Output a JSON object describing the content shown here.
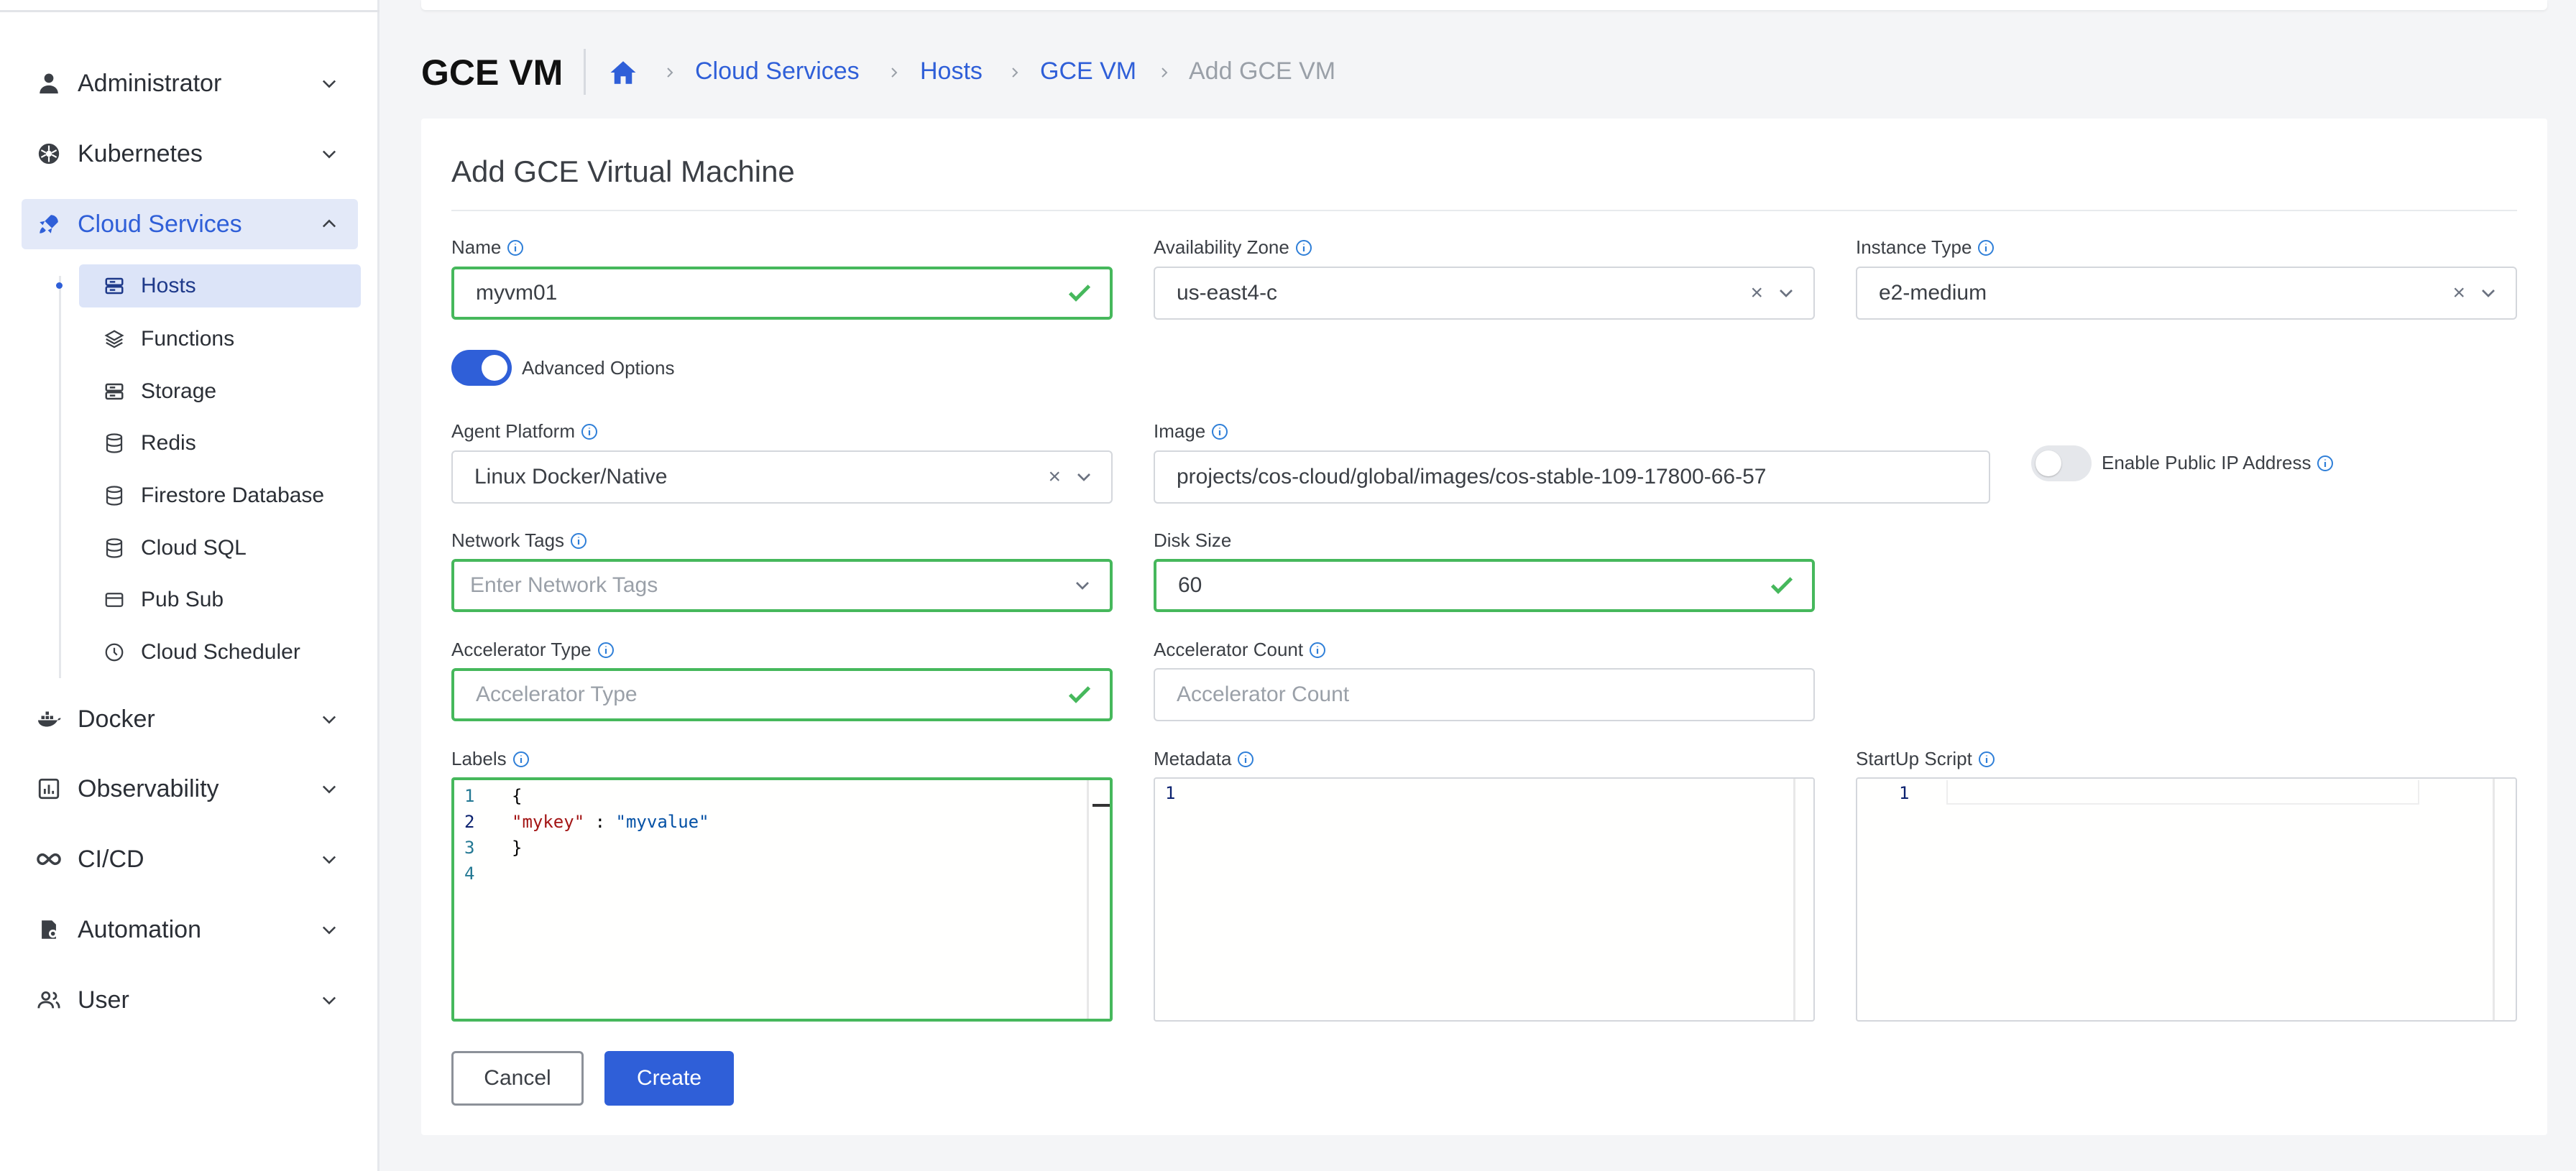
{
  "sidebar": {
    "items": [
      {
        "label": "Administrator",
        "icon": "user-icon"
      },
      {
        "label": "Kubernetes",
        "icon": "kubernetes-icon"
      },
      {
        "label": "Cloud Services",
        "icon": "rocket-icon"
      },
      {
        "label": "Docker",
        "icon": "docker-icon"
      },
      {
        "label": "Observability",
        "icon": "chart-icon"
      },
      {
        "label": "CI/CD",
        "icon": "infinity-icon"
      },
      {
        "label": "Automation",
        "icon": "automation-icon"
      },
      {
        "label": "User",
        "icon": "users-icon"
      }
    ],
    "subitems": [
      {
        "label": "Hosts",
        "icon": "server-icon"
      },
      {
        "label": "Functions",
        "icon": "layers-icon"
      },
      {
        "label": "Storage",
        "icon": "server-icon"
      },
      {
        "label": "Redis",
        "icon": "database-icon"
      },
      {
        "label": "Firestore Database",
        "icon": "database-icon"
      },
      {
        "label": "Cloud SQL",
        "icon": "database-icon"
      },
      {
        "label": "Pub Sub",
        "icon": "card-icon"
      },
      {
        "label": "Cloud Scheduler",
        "icon": "clock-icon"
      }
    ]
  },
  "header": {
    "title": "GCE VM",
    "breadcrumb": [
      "Cloud Services",
      "Hosts",
      "GCE VM",
      "Add GCE VM"
    ]
  },
  "form": {
    "title": "Add GCE Virtual Machine",
    "name_label": "Name",
    "name_value": "myvm01",
    "zone_label": "Availability Zone",
    "zone_value": "us-east4-c",
    "instance_label": "Instance Type",
    "instance_value": "e2-medium",
    "advanced_label": "Advanced Options",
    "advanced_on": true,
    "agent_label": "Agent Platform",
    "agent_value": "Linux Docker/Native",
    "image_label": "Image",
    "image_value": "projects/cos-cloud/global/images/cos-stable-109-17800-66-57",
    "public_ip_label": "Enable Public IP Address",
    "public_ip_on": false,
    "network_label": "Network Tags",
    "network_placeholder": "Enter Network Tags",
    "disk_label": "Disk Size",
    "disk_value": "60",
    "accel_type_label": "Accelerator Type",
    "accel_type_placeholder": "Accelerator Type",
    "accel_count_label": "Accelerator Count",
    "accel_count_placeholder": "Accelerator Count",
    "labels_label": "Labels",
    "labels_lines": [
      {
        "num": "1",
        "text": "{"
      },
      {
        "num": "2",
        "key": "\"mykey\"",
        "sep": " : ",
        "val": "\"myvalue\""
      },
      {
        "num": "3",
        "text": "}"
      },
      {
        "num": "4",
        "text": ""
      }
    ],
    "metadata_label": "Metadata",
    "metadata_line": "1",
    "startup_label": "StartUp Script",
    "startup_line": "1",
    "cancel_label": "Cancel",
    "create_label": "Create",
    "clear_symbol": "×"
  },
  "colors": {
    "accent": "#2f5fd8",
    "valid": "#46b85c"
  }
}
